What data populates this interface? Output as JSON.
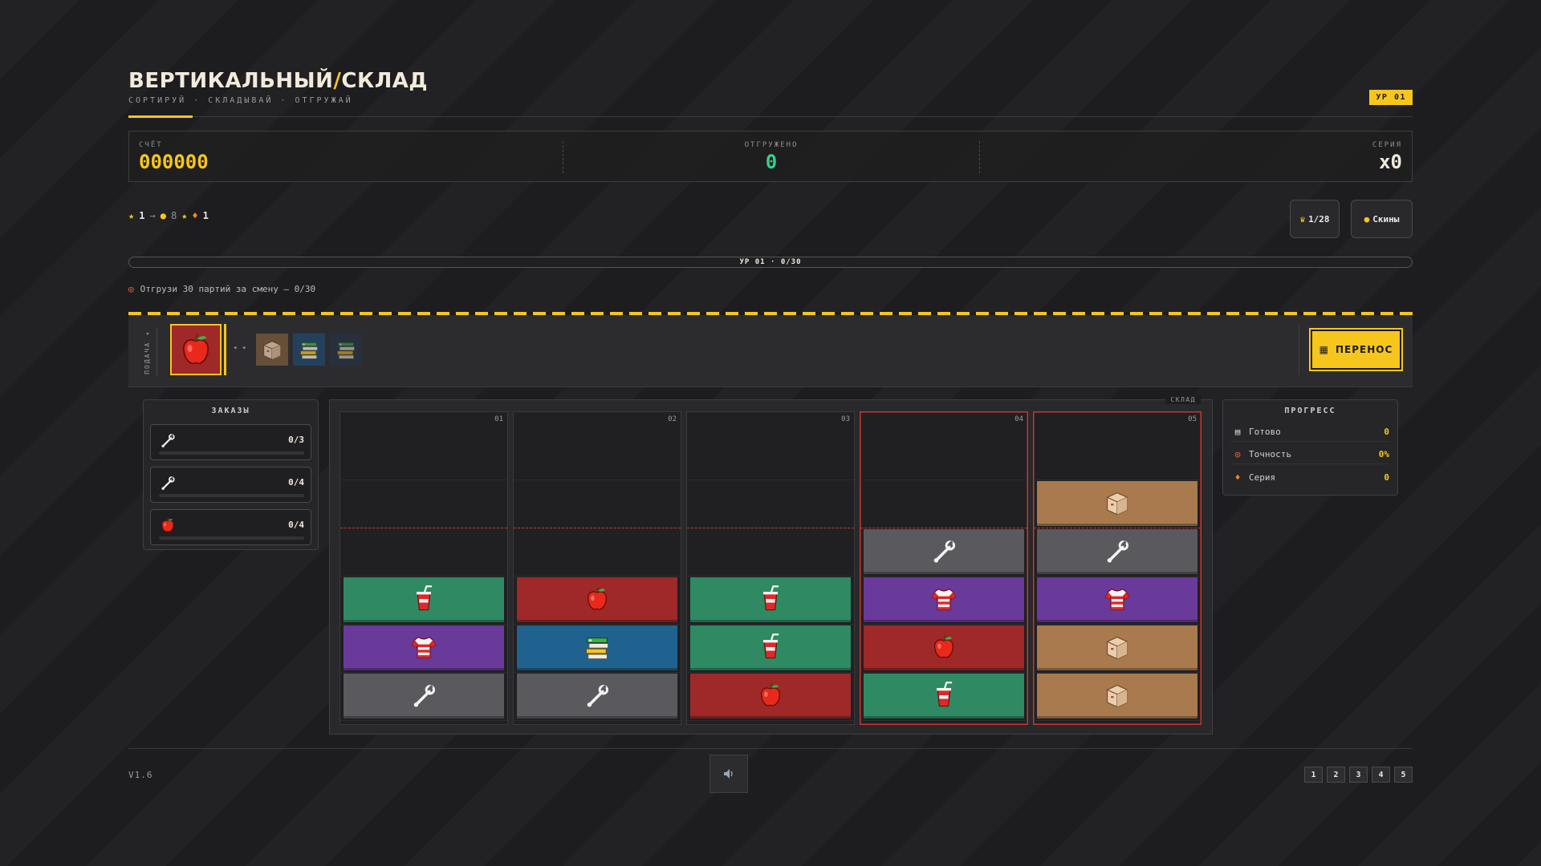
{
  "header": {
    "title_part1": "ВЕРТИКАЛЬНЫЙ",
    "title_sep": "/",
    "title_part2": "СКЛАД",
    "subtitle": "СОРТИРУЙ · СКЛАДЫВАЙ · ОТГРУЖАЙ",
    "level_badge": "УР 01"
  },
  "scorebar": {
    "score_label": "СЧЁТ",
    "score_value": "000000",
    "shipped_label": "ОТГРУЖЕНО",
    "shipped_value": "0",
    "streak_label": "СЕРИЯ",
    "streak_value": "x0"
  },
  "meta": {
    "stars": "1",
    "arrow": "→",
    "coins": "8",
    "flames": "1",
    "trophy_label": "1/28",
    "skins_label": "Скины"
  },
  "level_progress": {
    "text": "УР 01 · 0/30",
    "fraction": 0.0
  },
  "goal": {
    "text": "Отгрузи 30 партий за смену — 0/30"
  },
  "conveyor": {
    "feed_label": "ПОДАЧА ◂",
    "arrows": "◂ ◂",
    "current_item": "apple",
    "next_items": [
      "box",
      "books",
      "books"
    ],
    "transfer_label": "ПЕРЕНОС"
  },
  "orders": {
    "title": "ЗАКАЗЫ",
    "items": [
      {
        "icon": "wrench",
        "value": "0/3",
        "fraction": 0
      },
      {
        "icon": "wrench",
        "value": "0/4",
        "fraction": 0
      },
      {
        "icon": "apple",
        "value": "0/4",
        "fraction": 0
      }
    ]
  },
  "warehouse": {
    "tag": "СКЛАД",
    "columns": [
      {
        "num": "01",
        "warn": false,
        "items": [
          "wrench",
          "shirt",
          "cup"
        ]
      },
      {
        "num": "02",
        "warn": false,
        "items": [
          "wrench",
          "books",
          "apple"
        ]
      },
      {
        "num": "03",
        "warn": false,
        "items": [
          "apple",
          "cup",
          "cup"
        ]
      },
      {
        "num": "04",
        "warn": true,
        "items": [
          "cup",
          "apple",
          "shirt",
          "wrench"
        ]
      },
      {
        "num": "05",
        "warn": true,
        "items": [
          "box",
          "box",
          "shirt",
          "wrench",
          "box"
        ]
      }
    ]
  },
  "progress": {
    "title": "ПРОГРЕСС",
    "rows": [
      {
        "icon": "clipboard-icon",
        "label": "Готово",
        "value": "0"
      },
      {
        "icon": "target-icon",
        "label": "Точность",
        "value": "0%"
      },
      {
        "icon": "flame-icon",
        "label": "Серия",
        "value": "0"
      }
    ]
  },
  "footer": {
    "version": "V1.6",
    "level_buttons": [
      "1",
      "2",
      "3",
      "4",
      "5"
    ]
  },
  "colors": {
    "accent": "#f6c61d",
    "green": "#2f8a63",
    "purple": "#6a3a9b",
    "gray": "#5a5a5e",
    "red": "#9f2828",
    "blue": "#20628f",
    "brown": "#a87a4e",
    "warn": "#c9372d"
  }
}
